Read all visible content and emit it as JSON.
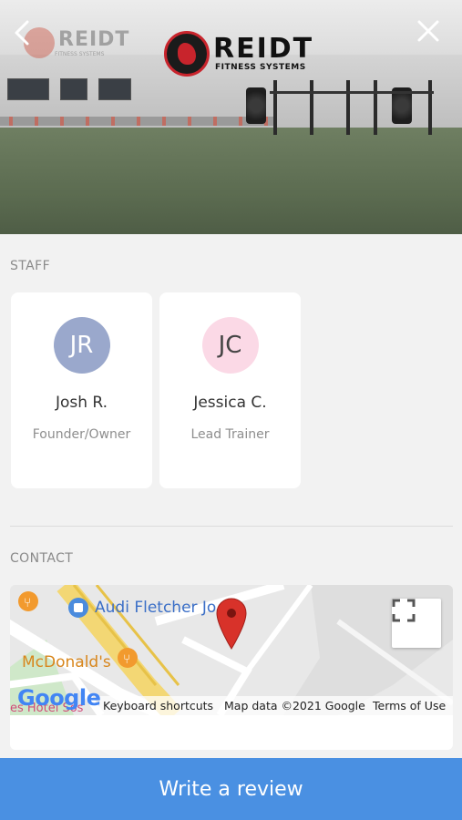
{
  "hero": {
    "logo_brand": "REIDT",
    "logo_tagline": "FITNESS SYSTEMS",
    "wall_logo_brand": "REIDT",
    "wall_logo_tagline": "FITNESS SYSTEMS",
    "back_icon": "chevron-left-icon",
    "close_icon": "close-icon"
  },
  "staff": {
    "title": "STAFF",
    "members": [
      {
        "initials": "JR",
        "name": "Josh R.",
        "role": "Founder/Owner",
        "avatar_bg": "#9aa8cc",
        "avatar_fg": "#ffffff"
      },
      {
        "initials": "JC",
        "name": "Jessica C.",
        "role": "Lead Trainer",
        "avatar_bg": "#fbd9e6",
        "avatar_fg": "#444444"
      }
    ]
  },
  "contact": {
    "title": "CONTACT",
    "map": {
      "place_labels": [
        "Audi Fletcher Jo",
        "McDonald's",
        "es Hotel Sos"
      ],
      "marker_icon": "map-pin-icon",
      "expand_icon": "fullscreen-icon",
      "google_logo": "Google",
      "attribution": {
        "shortcuts": "Keyboard shortcuts",
        "data": "Map data ©2021 Google",
        "terms": "Terms of Use"
      }
    }
  },
  "footer": {
    "review_button": "Write a review",
    "button_color": "#4a90e2"
  }
}
